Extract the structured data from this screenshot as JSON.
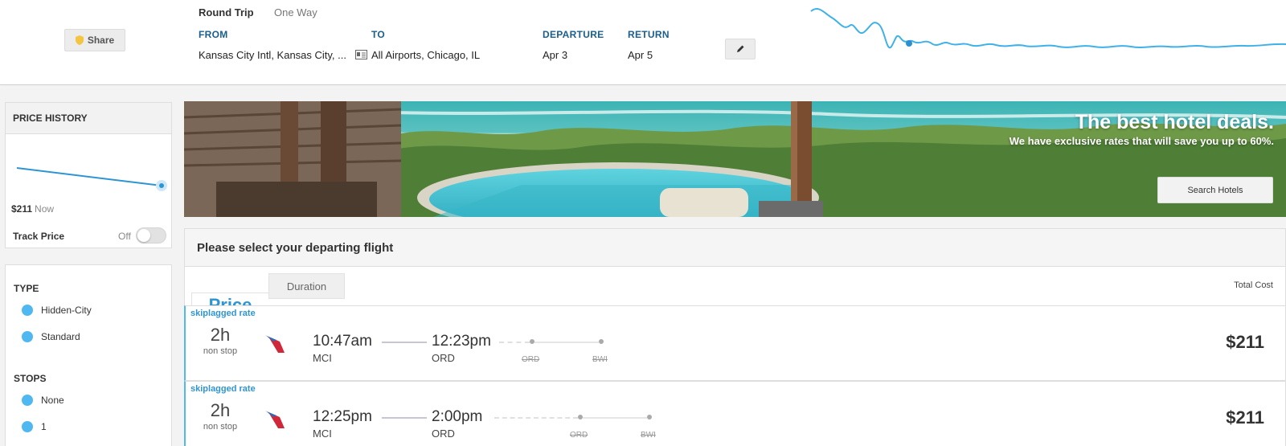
{
  "header": {
    "share_label": "Share",
    "trip_types": [
      "Round Trip",
      "One Way"
    ],
    "from_label": "FROM",
    "from_value": "Kansas City Intl, Kansas City, ...",
    "to_label": "TO",
    "to_value": "All Airports, Chicago, IL",
    "departure_label": "DEPARTURE",
    "departure_value": "Apr 3",
    "return_label": "RETURN",
    "return_value": "Apr 5"
  },
  "price_history": {
    "title": "PRICE HISTORY",
    "price": "$211",
    "price_note": "Now",
    "track_label": "Track Price",
    "track_state": "Off"
  },
  "filters": {
    "type_title": "TYPE",
    "type_options": [
      "Hidden-City",
      "Standard"
    ],
    "stops_title": "STOPS",
    "stops_options": [
      "None",
      "1"
    ]
  },
  "banner": {
    "title": "The best hotel deals.",
    "subtitle": "We have exclusive rates that will save you up to 60%.",
    "button": "Search Hotels"
  },
  "results": {
    "heading": "Please select your departing flight",
    "sort_tabs": [
      "Price",
      "Duration"
    ],
    "total_cost_label": "Total Cost",
    "flights": [
      {
        "rate": "skiplagged rate",
        "duration": "2h",
        "stops": "non stop",
        "depart_time": "10:47am",
        "depart_code": "MCI",
        "arrive_time": "12:23pm",
        "arrive_code": "ORD",
        "hidden_stops": [
          "ORD",
          "BWI"
        ],
        "price": "$211"
      },
      {
        "rate": "skiplagged rate",
        "duration": "2h",
        "stops": "non stop",
        "depart_time": "12:25pm",
        "depart_code": "MCI",
        "arrive_time": "2:00pm",
        "arrive_code": "ORD",
        "hidden_stops": [
          "ORD",
          "BWI"
        ],
        "price": "$211"
      }
    ]
  },
  "colors": {
    "accent": "#2e95d3",
    "filter_dot": "#4fb8f0",
    "label_blue": "#1a5e8c"
  },
  "icons": [
    "shield-icon",
    "id-card-icon",
    "pencil-icon",
    "american-airlines-icon"
  ]
}
